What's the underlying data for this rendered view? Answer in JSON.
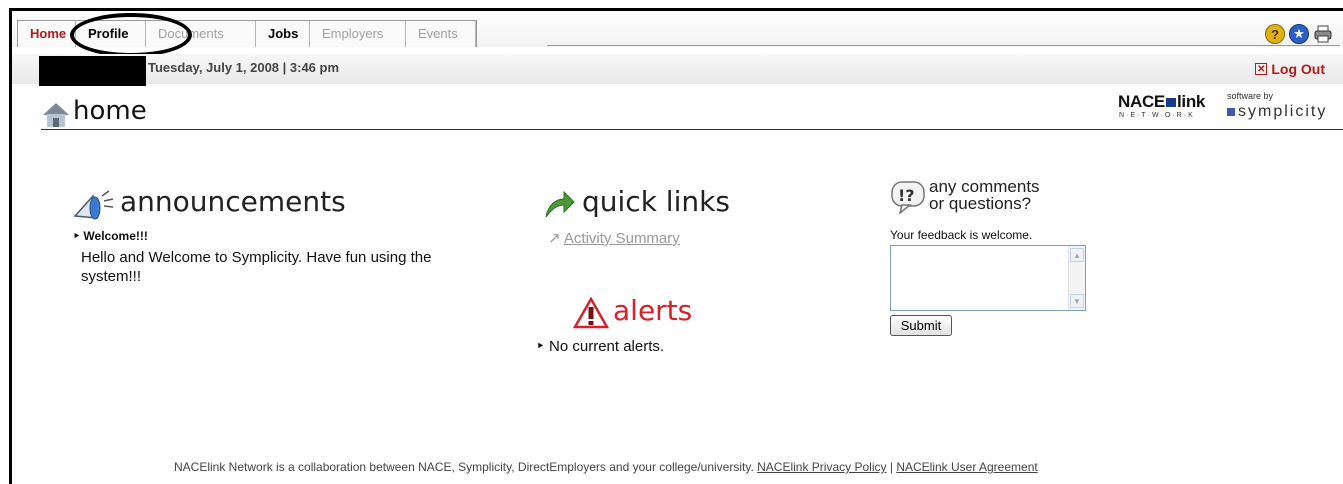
{
  "nav": {
    "tabs": [
      {
        "label": "Home"
      },
      {
        "label": "Profile"
      },
      {
        "label": "Documents"
      },
      {
        "label": "Jobs"
      },
      {
        "label": "Employers"
      },
      {
        "label": "Events"
      }
    ],
    "icons": [
      "help-icon",
      "accessibility-icon",
      "print-icon"
    ]
  },
  "header": {
    "date": "Tuesday, July 1, 2008 | 3:46 pm",
    "logout": "Log Out",
    "page_title": "home",
    "brand_nace": "NACE",
    "brand_link": "link",
    "brand_network": "N·E·T·W·O·R·K",
    "brand_by": "software by",
    "brand_symplicity": "symplicity"
  },
  "announcements": {
    "title": "announcements",
    "item_title": "Welcome!!!",
    "item_body": "Hello and Welcome to Symplicity. Have fun using the system!!!"
  },
  "quick_links": {
    "title": "quick links",
    "links": [
      "Activity Summary"
    ]
  },
  "alerts": {
    "title": "alerts",
    "body": "No current alerts."
  },
  "comments": {
    "title_line1": "any comments",
    "title_line2": "or questions?",
    "label": "Your feedback is welcome.",
    "submit": "Submit"
  },
  "footer": {
    "text": "NACElink Network is a collaboration between NACE, Symplicity, DirectEmployers and your college/university.",
    "privacy": "NACElink Privacy Policy",
    "separator": "|",
    "agreement": "NACElink User Agreement"
  },
  "colors": {
    "accent_red": "#b01b1b",
    "alert_red": "#d6202a",
    "link_gray": "#999999"
  }
}
